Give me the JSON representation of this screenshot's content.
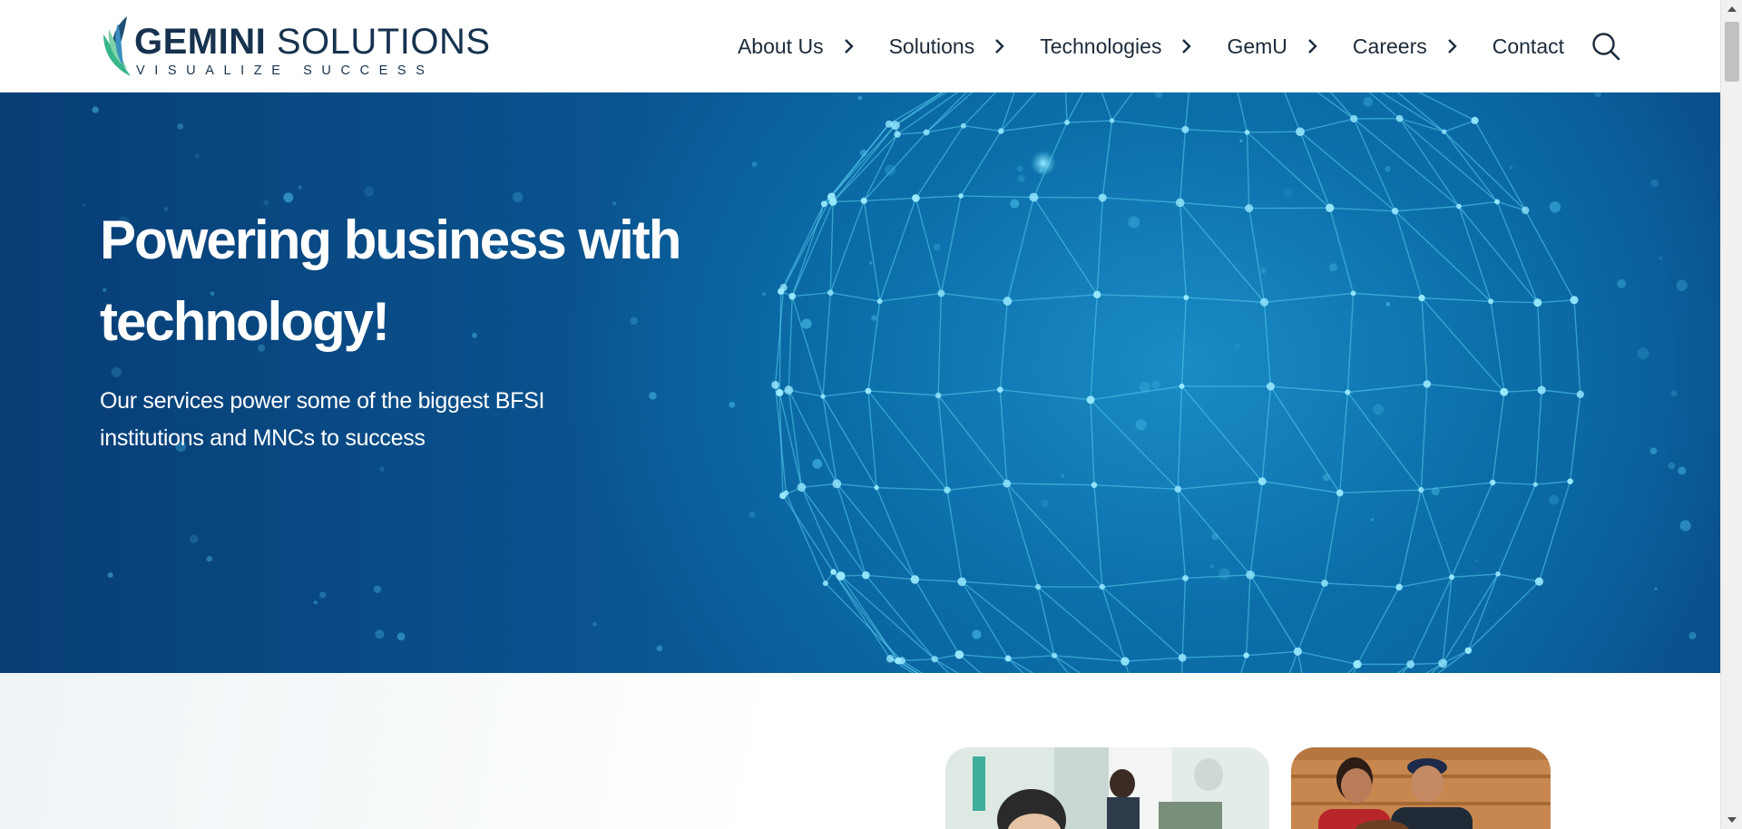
{
  "header": {
    "logo": {
      "name_bold": "GEMINI",
      "name_regular": "SOLUTIONS",
      "tagline": "VISUALIZE SUCCESS",
      "icon": "leaf-logo-icon"
    },
    "nav": {
      "items": [
        {
          "label": "About Us",
          "icon": "chevron-right-icon"
        },
        {
          "label": "Solutions",
          "icon": "chevron-right-icon"
        },
        {
          "label": "Technologies",
          "icon": "chevron-right-icon"
        },
        {
          "label": "GemU",
          "icon": "chevron-right-icon"
        },
        {
          "label": "Careers",
          "icon": "chevron-right-icon"
        }
      ],
      "contact_label": "Contact",
      "search_icon": "search-icon"
    }
  },
  "hero": {
    "title": "Powering business with technology!",
    "subtitle": "Our services power some of the biggest BFSI institutions and MNCs to success"
  },
  "colors": {
    "brand_navy": "#16324f",
    "hero_blue": "#0b6aa6",
    "network_cyan": "#5fd3f0",
    "leaf_green": "#2fae7e"
  }
}
